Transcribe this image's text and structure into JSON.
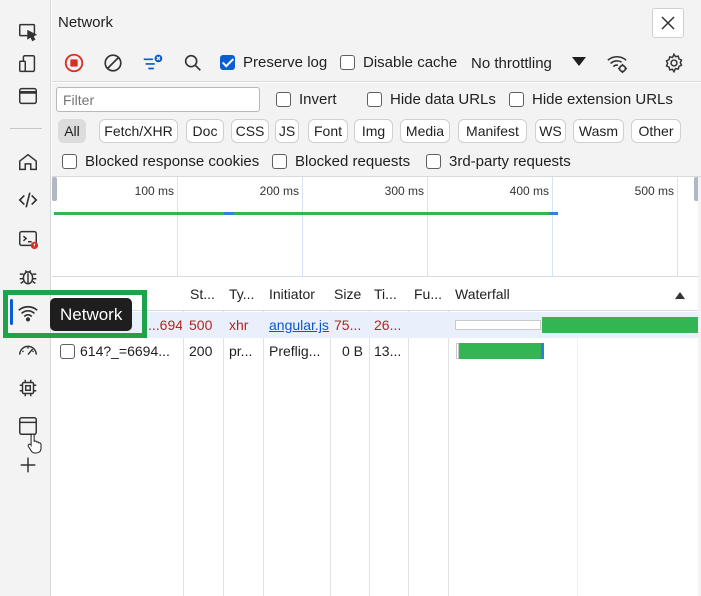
{
  "panel": {
    "title": "Network"
  },
  "tooltip": {
    "text": "Network"
  },
  "toolbar": {
    "preserve_log": {
      "label": "Preserve log",
      "checked": true
    },
    "disable_cache": {
      "label": "Disable cache",
      "checked": false
    },
    "throttling": "No throttling"
  },
  "filter": {
    "placeholder": "Filter",
    "invert": "Invert",
    "hide_data_urls": "Hide data URLs",
    "hide_extension_urls": "Hide extension URLs"
  },
  "types": [
    "All",
    "Fetch/XHR",
    "Doc",
    "CSS",
    "JS",
    "Font",
    "Img",
    "Media",
    "Manifest",
    "WS",
    "Wasm",
    "Other"
  ],
  "blocked": {
    "response_cookies": "Blocked response cookies",
    "requests": "Blocked requests",
    "third_party": "3rd-party requests"
  },
  "overview": {
    "ticks": [
      "100 ms",
      "200 ms",
      "300 ms",
      "400 ms",
      "500 ms"
    ]
  },
  "table": {
    "headers": {
      "status": "St...",
      "type": "Ty...",
      "initiator": "Initiator",
      "size": "Size",
      "time": "Ti...",
      "fulfilled": "Fu...",
      "waterfall": "Waterfall"
    },
    "rows": [
      {
        "name": "...694...",
        "status": "500",
        "type": "xhr",
        "initiator": "angular.js",
        "size": "75...",
        "time": "26..."
      },
      {
        "name": "614?_=6694...",
        "status": "200",
        "type": "pr...",
        "initiator": "Preflig...",
        "size": "0 B",
        "time": "13..."
      }
    ]
  },
  "colors": {
    "accent": "#0b5fd3",
    "highlight": "#1fa34a",
    "error_text": "#b3261e",
    "waterfall_green": "#34b553"
  },
  "icons": [
    "inspect-icon",
    "device-toolbar-icon",
    "window-icon",
    "home-icon",
    "elements-icon",
    "console-icon",
    "bug-icon",
    "wifi-icon",
    "performance-icon",
    "memory-chip-icon",
    "application-icon",
    "plus-icon",
    "close-icon",
    "record-stop-icon",
    "clear-icon",
    "filter-settings-icon",
    "search-icon",
    "network-conditions-icon",
    "gear-icon"
  ]
}
